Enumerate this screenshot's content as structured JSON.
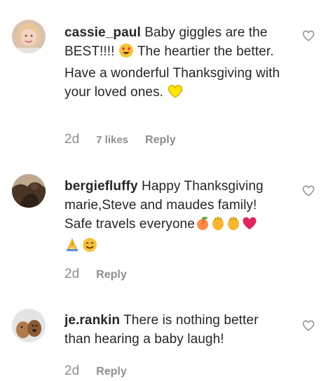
{
  "comments": [
    {
      "username": "cassie_paul",
      "text_parts": [
        "Baby giggles are the BEST!!!! ",
        " The heartier the better. Have a wonderful Thanksgiving with your loved ones. "
      ],
      "emojis": [
        "heart-eyes-emoji",
        "yellow-heart-emoji"
      ],
      "time": "2d",
      "likes": "7 likes",
      "reply": "Reply"
    },
    {
      "username": "bergiefluffy",
      "text_parts": [
        "Happy Thanksgiving marie,Steve and maudes family! Safe travels everyone"
      ],
      "emojis": [
        "peach-emoji",
        "clapping-hands-emoji",
        "clapping-hands-emoji",
        "red-heart-emoji",
        "folded-hands-emoji",
        "smiling-face-emoji"
      ],
      "time": "2d",
      "reply": "Reply"
    },
    {
      "username": "je.rankin",
      "text_parts": [
        "There is nothing better than hearing a baby laugh!"
      ],
      "time": "2d",
      "reply": "Reply"
    }
  ],
  "colors": {
    "text": "#262626",
    "meta": "#8e8e8e",
    "heart_outline": "#8e8e8e"
  }
}
